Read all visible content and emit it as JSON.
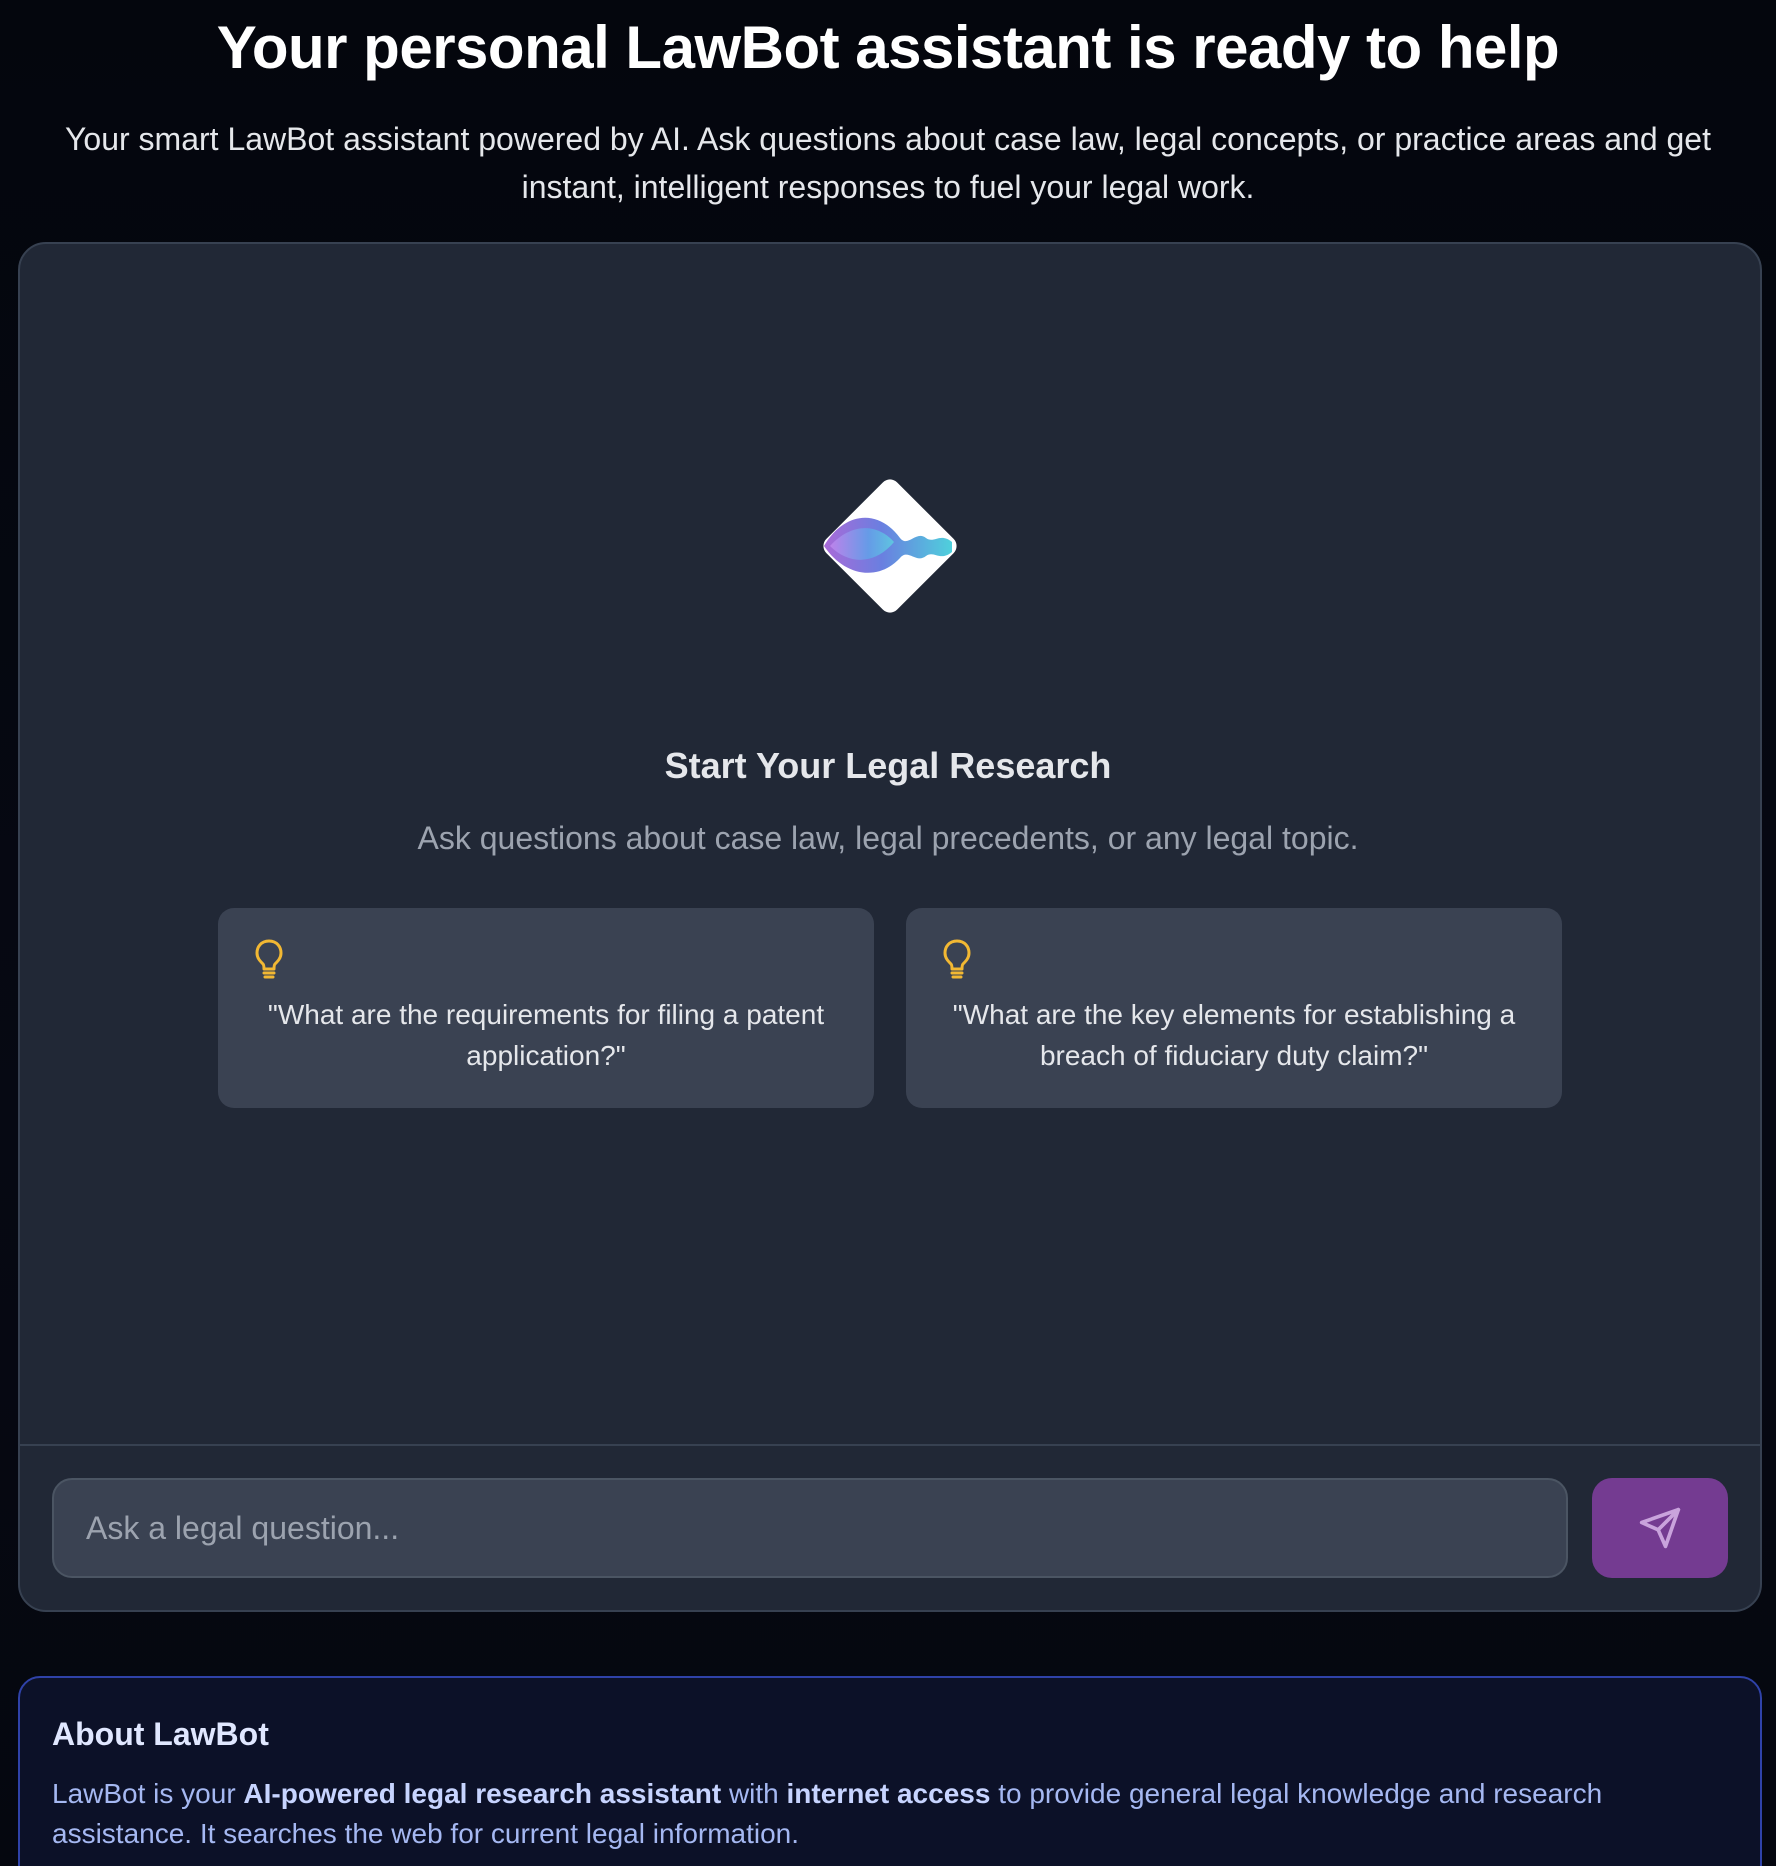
{
  "hero": {
    "title": "Your personal LawBot assistant is ready to help",
    "subtitle": "Your smart LawBot assistant powered by AI. Ask questions about case law, legal concepts, or practice areas and get instant, intelligent responses to fuel your legal work."
  },
  "chat": {
    "logo_icon": "lawbot-diamond-wave-logo",
    "empty_title": "Start Your Legal Research",
    "empty_subtitle": "Ask questions about case law, legal precedents, or any legal topic.",
    "suggestions": [
      {
        "icon": "lightbulb-icon",
        "text": "\"What are the requirements for filing a patent application?\""
      },
      {
        "icon": "lightbulb-icon",
        "text": "\"What are the key elements for establishing a breach of fiduciary duty claim?\""
      }
    ],
    "input": {
      "placeholder": "Ask a legal question...",
      "value": ""
    },
    "send_icon": "send-paper-plane-icon"
  },
  "about": {
    "title": "About LawBot",
    "text_1": "LawBot is your ",
    "highlight_1": "AI-powered legal research assistant",
    "text_2": " with ",
    "highlight_2": "internet access",
    "text_3": " to provide general legal knowledge and research assistance. It searches the web for current legal information."
  },
  "colors": {
    "page_bg": "#05070f",
    "card_bg": "#212836",
    "suggestion_bg": "#3a4252",
    "accent_send": "#743b91",
    "bulb": "#f2b833",
    "about_bg": "#0c1128",
    "about_border": "#2f42a8",
    "about_text": "#a5b8f2"
  }
}
